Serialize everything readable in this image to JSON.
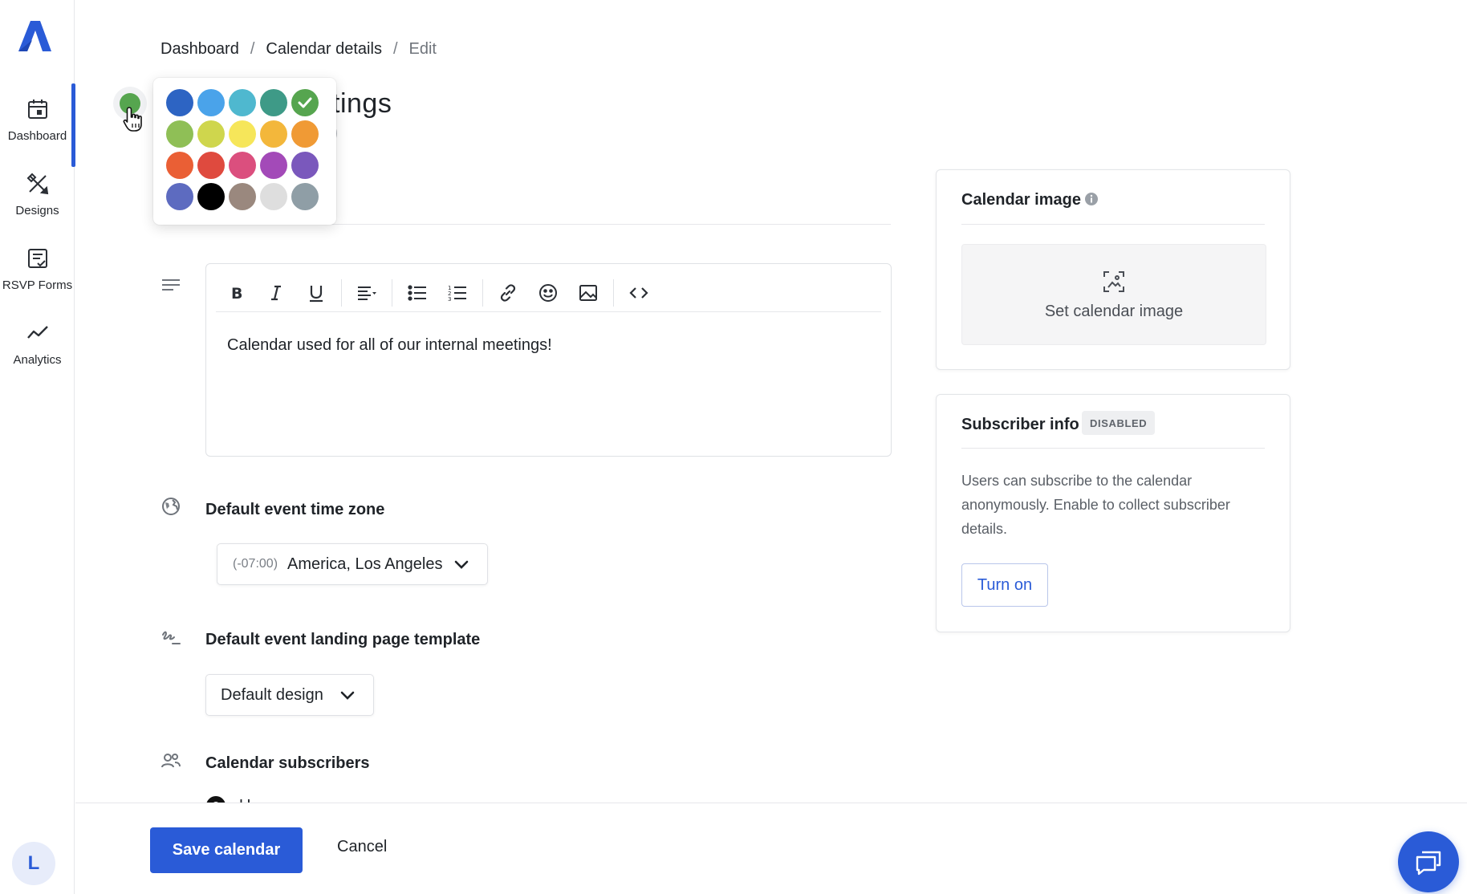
{
  "sidebar": {
    "items": [
      {
        "label": "Dashboard",
        "icon": "calendar-icon"
      },
      {
        "label": "Designs",
        "icon": "design-tools-icon"
      },
      {
        "label": "RSVP Forms",
        "icon": "form-checklist-icon"
      },
      {
        "label": "Analytics",
        "icon": "analytics-line-icon"
      }
    ],
    "avatar_initial": "L"
  },
  "breadcrumb": {
    "items": [
      "Dashboard",
      "Calendar details"
    ],
    "separator": "/",
    "current": "Edit"
  },
  "calendar": {
    "color": "#56a54f",
    "title_visible": "tings",
    "title_suffix_visible": ")"
  },
  "palette": {
    "colors": [
      "#2d64c3",
      "#4aa3ea",
      "#4fb8cf",
      "#3e9a87",
      "#56a54f",
      "#8fbf56",
      "#cfd64d",
      "#f6e65a",
      "#f3b73b",
      "#f09a35",
      "#ea5f35",
      "#df4a3e",
      "#db4f7e",
      "#a34ab8",
      "#7a58bc",
      "#5d6bc0",
      "#000000",
      "#9a887e",
      "#dedede",
      "#8f9ea6"
    ],
    "selected_index": 4
  },
  "editor": {
    "toolbar": [
      "bold",
      "italic",
      "underline",
      "align",
      "bullet-list",
      "numbered-list",
      "link",
      "emoji",
      "image",
      "code"
    ],
    "content": "Calendar used for all of our internal meetings!"
  },
  "timezone": {
    "label": "Default event time zone",
    "offset": "(-07:00)",
    "value": "America, Los Angeles"
  },
  "template": {
    "label": "Default event landing page template",
    "value": "Default design"
  },
  "subscribers": {
    "label": "Calendar subscribers",
    "first_option_partial": "U"
  },
  "image_card": {
    "title": "Calendar image",
    "action": "Set calendar image"
  },
  "subscriber_card": {
    "title": "Subscriber info",
    "badge": "DISABLED",
    "body": "Users can subscribe to the calendar anonymously. Enable to collect subscriber details.",
    "button": "Turn on"
  },
  "footer": {
    "save": "Save calendar",
    "cancel": "Cancel"
  },
  "colors": {
    "accent": "#2a5bd7"
  }
}
